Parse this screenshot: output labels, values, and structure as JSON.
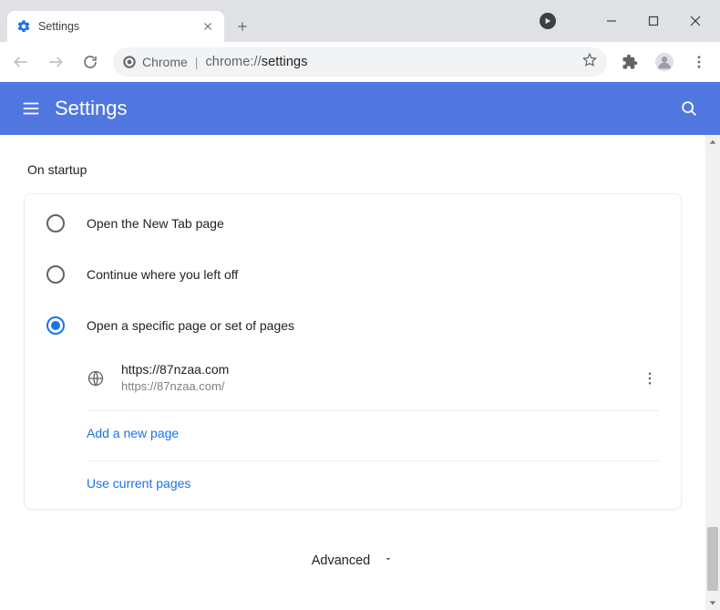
{
  "window": {
    "tab_title": "Settings",
    "omnibox_chip": "Chrome",
    "omnibox_prefix": "chrome://",
    "omnibox_path": "settings"
  },
  "header": {
    "title": "Settings"
  },
  "section": {
    "title": "On startup"
  },
  "options": {
    "new_tab": "Open the New Tab page",
    "continue": "Continue where you left off",
    "specific": "Open a specific page or set of pages"
  },
  "page_entry": {
    "title": "https://87nzaa.com",
    "url": "https://87nzaa.com/"
  },
  "links": {
    "add": "Add a new page",
    "use_current": "Use current pages"
  },
  "footer": {
    "advanced": "Advanced"
  }
}
